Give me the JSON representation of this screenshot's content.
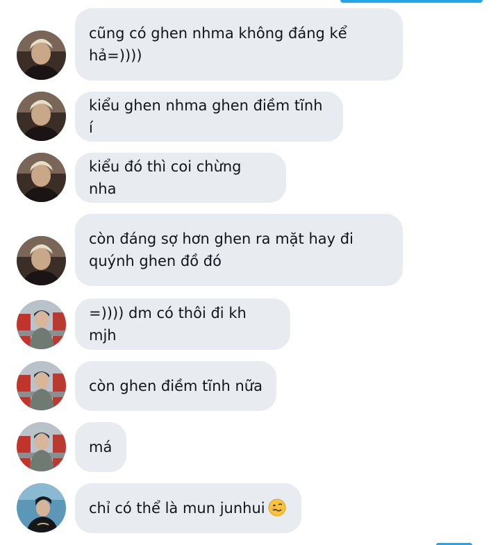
{
  "conversation": {
    "messages": [
      {
        "avatar": "avatar-blond-man",
        "text": "cũng có ghen nhma không đáng kể\nhả=))))"
      },
      {
        "avatar": "avatar-blond-man",
        "text": "kiểu ghen nhma ghen điềm tĩnh í"
      },
      {
        "avatar": "avatar-blond-man",
        "text": "kiểu đó thì coi chừng nha"
      },
      {
        "avatar": "avatar-blond-man",
        "text": "còn đáng sợ hơn ghen ra mặt hay đi\nquýnh ghen đồ đó"
      },
      {
        "avatar": "avatar-beanie-man",
        "text": "=)))) dm có thôi đi kh mjh"
      },
      {
        "avatar": "avatar-beanie-man",
        "text": "còn ghen điềm tĩnh nữa"
      },
      {
        "avatar": "avatar-beanie-man",
        "text": "má"
      },
      {
        "avatar": "avatar-teal-portrait",
        "text": "chỉ có thể là mun junhui",
        "emoji": "woozy-face-emoji"
      }
    ]
  },
  "colors": {
    "bubble_received": "#e8ecf1",
    "text": "#111418",
    "sent_accent": "#26a4e6"
  }
}
